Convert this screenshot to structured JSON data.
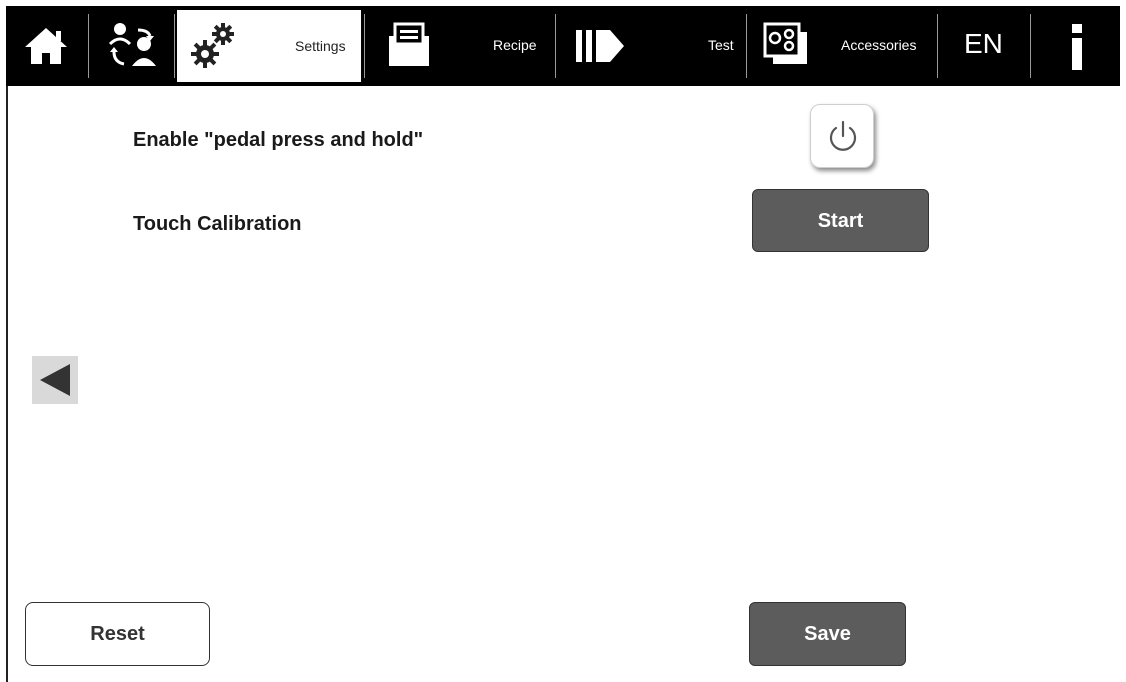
{
  "nav": {
    "home_icon": "home-icon",
    "users_icon": "user-switch-icon",
    "settings": {
      "label": "Settings",
      "icon": "gears-icon",
      "active": true
    },
    "recipe": {
      "label": "Recipe",
      "icon": "recipe-icon"
    },
    "test": {
      "label": "Test",
      "icon": "test-arrow-icon"
    },
    "accessories": {
      "label": "Accessories",
      "icon": "accessories-icon"
    },
    "language": "EN",
    "info": "i"
  },
  "settings": {
    "pedal_label": "Enable \"pedal press and hold\"",
    "pedal_icon": "power-icon",
    "touch_label": "Touch Calibration",
    "start_label": "Start"
  },
  "footer": {
    "reset_label": "Reset",
    "save_label": "Save"
  },
  "colors": {
    "navbar": "#000000",
    "button_dark": "#5c5c5c",
    "active_tab": "#ffffff"
  }
}
